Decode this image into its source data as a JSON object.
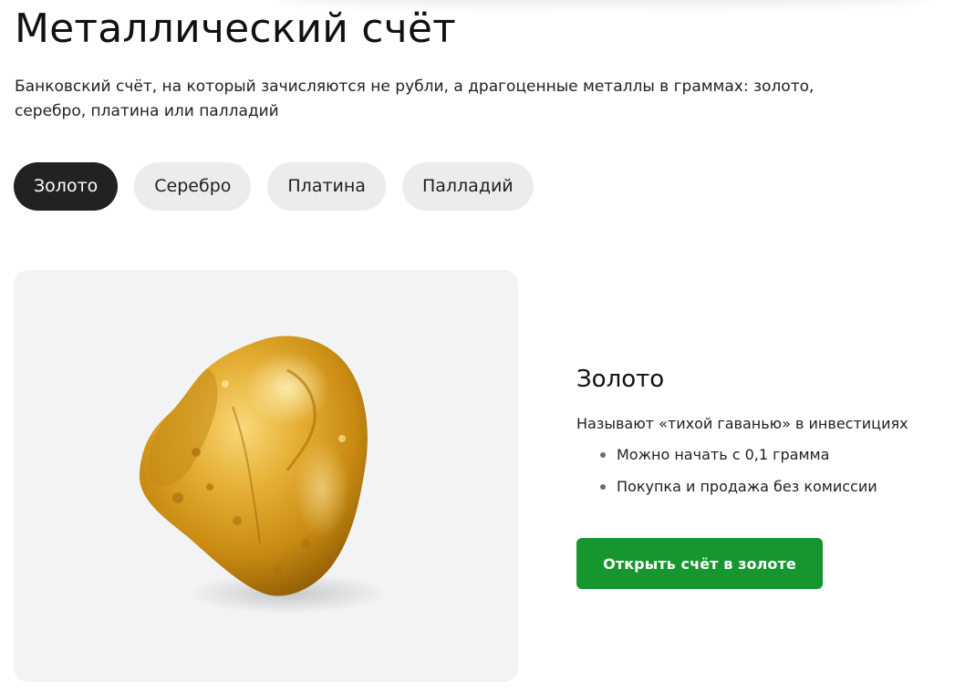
{
  "page": {
    "title": "Металлический счёт",
    "lead": "Банковский счёт, на который зачисляются не рубли, а драгоценные металлы в граммах: золото, серебро, платина или палладий"
  },
  "tabs": [
    {
      "label": "Золото",
      "active": true
    },
    {
      "label": "Серебро",
      "active": false
    },
    {
      "label": "Платина",
      "active": false
    },
    {
      "label": "Палладий",
      "active": false
    }
  ],
  "product": {
    "image": "gold-nugget",
    "title": "Золото",
    "subtitle": "Называют «тихой гаванью» в инвестициях",
    "features": [
      "Можно начать с 0,1 грамма",
      "Покупка и продажа без комиссии"
    ],
    "cta_label": "Открыть счёт в золоте"
  },
  "colors": {
    "active_tab": "#222224",
    "inactive_tab": "#ececec",
    "cta": "#15962f",
    "card_background": "#f2f3f5",
    "gold": "#e0a92a"
  }
}
